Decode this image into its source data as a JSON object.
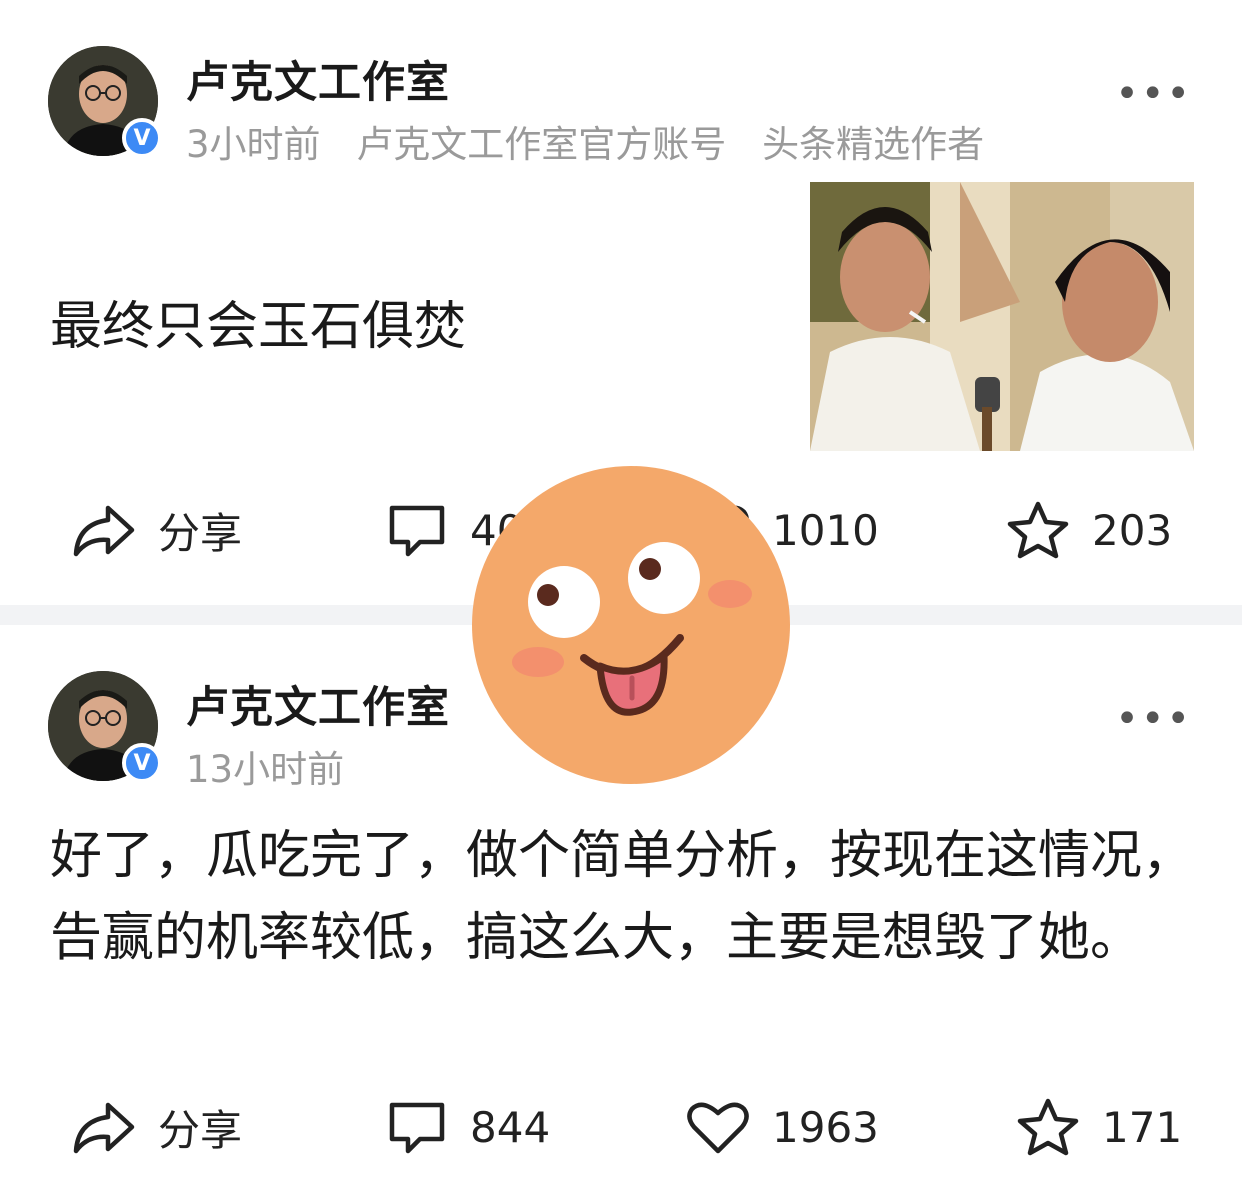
{
  "posts": [
    {
      "author": "卢克文工作室",
      "time": "3小时前",
      "tags": [
        "卢克文工作室官方账号",
        "头条精选作者"
      ],
      "text": "最终只会玉石俱焚",
      "has_image": true,
      "actions": {
        "share": "分享",
        "comments": "40",
        "likes": "1010",
        "favorites": "203"
      }
    },
    {
      "author": "卢克文工作室",
      "time": "13小时前",
      "text": "好了，瓜吃完了，做个简单分析，按现在这情况，告赢的机率较低，搞这么大，主要是想毁了她。",
      "actions": {
        "share": "分享",
        "comments": "844",
        "likes": "1963",
        "favorites": "171"
      }
    }
  ],
  "badge": "V",
  "icons": [
    "share-icon",
    "comment-icon",
    "like-icon",
    "favorite-icon",
    "more-icon",
    "verified-icon",
    "tongue-out-emoji"
  ],
  "colors": {
    "badge": "#3d8af5",
    "meta": "#9a9a9a",
    "emoji": "#f4a86a",
    "divider": "#f2f3f5"
  }
}
